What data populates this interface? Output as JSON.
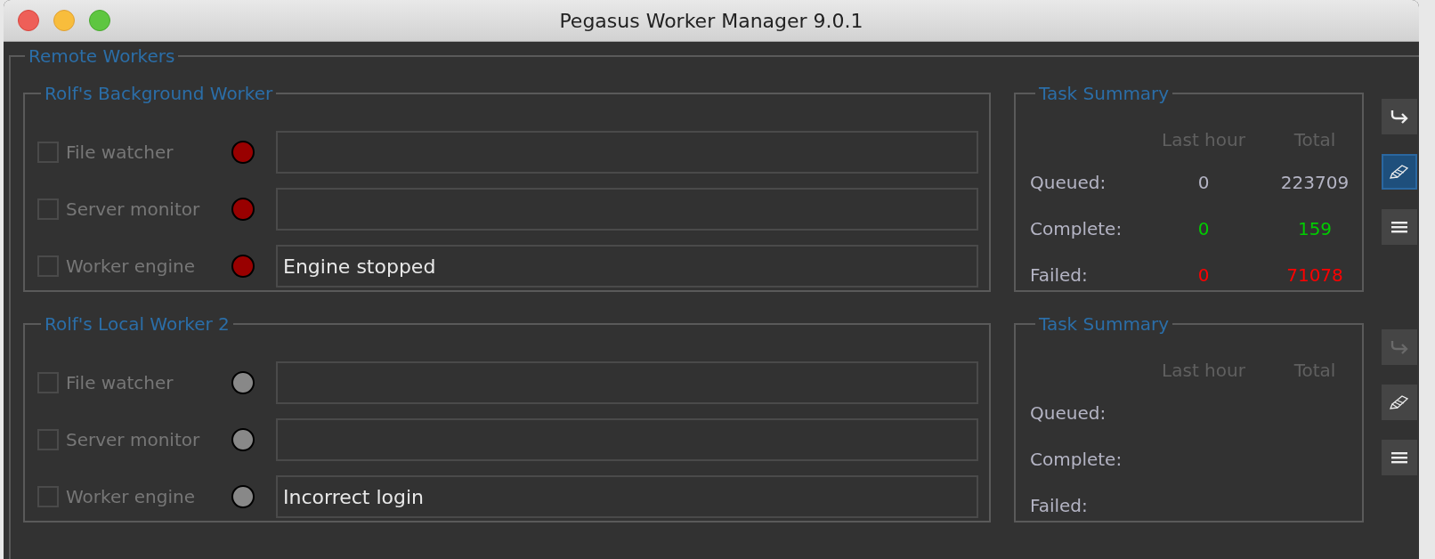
{
  "window": {
    "title": "Pegasus Worker Manager 9.0.1"
  },
  "section": {
    "title": "Remote Workers"
  },
  "workers": [
    {
      "name": "Rolf's Background Worker",
      "services": [
        {
          "label": "File watcher",
          "checked": false,
          "color": "#990000"
        },
        {
          "label": "Server monitor",
          "checked": false,
          "color": "#990000"
        },
        {
          "label": "Worker engine",
          "checked": false,
          "color": "#990000",
          "message": "Engine stopped"
        }
      ],
      "summary": {
        "title": "Task Summary",
        "columns": [
          "Last hour",
          "Total"
        ],
        "rows": [
          {
            "label": "Queued:",
            "last_hour": "0",
            "total": "223709",
            "color": "#b4b4c4"
          },
          {
            "label": "Complete:",
            "last_hour": "0",
            "total": "159",
            "color": "#00cc00"
          },
          {
            "label": "Failed:",
            "last_hour": "0",
            "total": "71078",
            "color": "#ff0000"
          }
        ]
      },
      "buttons": [
        {
          "kind": "forward",
          "selected": false,
          "disabled": false
        },
        {
          "kind": "edit",
          "selected": true,
          "disabled": false
        },
        {
          "kind": "menu",
          "selected": false,
          "disabled": false
        }
      ]
    },
    {
      "name": "Rolf's Local Worker 2",
      "services": [
        {
          "label": "File watcher",
          "checked": false,
          "color": "#888888"
        },
        {
          "label": "Server monitor",
          "checked": false,
          "color": "#888888"
        },
        {
          "label": "Worker engine",
          "checked": false,
          "color": "#888888",
          "message": "Incorrect login"
        }
      ],
      "summary": {
        "title": "Task Summary",
        "columns": [
          "Last hour",
          "Total"
        ],
        "rows": [
          {
            "label": "Queued:"
          },
          {
            "label": "Complete:"
          },
          {
            "label": "Failed:"
          }
        ]
      },
      "buttons": [
        {
          "kind": "forward",
          "selected": false,
          "disabled": true
        },
        {
          "kind": "edit",
          "selected": false,
          "disabled": false
        },
        {
          "kind": "menu",
          "selected": false,
          "disabled": false
        }
      ]
    }
  ]
}
